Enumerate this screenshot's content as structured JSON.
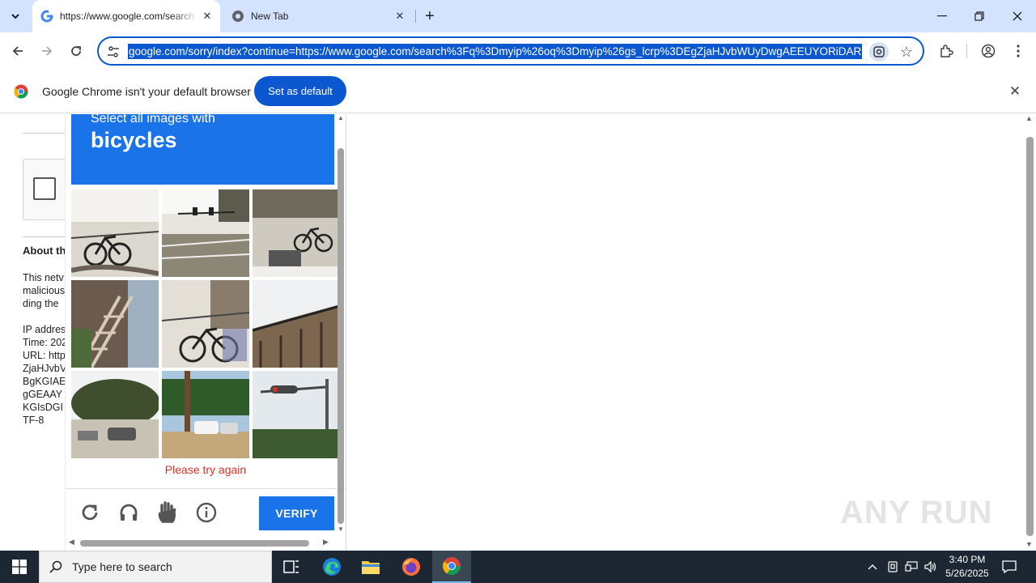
{
  "browser": {
    "tabs": [
      {
        "title": "https://www.google.com/search",
        "active": true
      },
      {
        "title": "New Tab",
        "active": false
      }
    ],
    "url": "google.com/sorry/index?continue=https://www.google.com/search%3Fq%3Dmyip%26oq%3Dmyip%26gs_lcrp%3DEgZjaHJvbWUyDwgAEEUYORiDAR",
    "infobar": {
      "message": "Google Chrome isn't your default browser",
      "button": "Set as default"
    }
  },
  "background_page": {
    "about_heading": "About th",
    "text_lines": [
      "This netv",
      "malicious",
      "ding the",
      "",
      "IP addres",
      "Time: 202",
      "URL: http",
      "ZjaHJvbV",
      "BgKGIAE",
      "gGEAAY",
      "KGIsDGI",
      "TF-8"
    ]
  },
  "captcha": {
    "instruction": "Select all images with",
    "target": "bicycles",
    "tiles": [
      {
        "label": "bicycle parked on sidewalk"
      },
      {
        "label": "street with traffic light"
      },
      {
        "label": "street with bicycle"
      },
      {
        "label": "stairs and railing"
      },
      {
        "label": "bicycle by fence"
      },
      {
        "label": "bridge"
      },
      {
        "label": "trees and cars"
      },
      {
        "label": "parking lot with RVs"
      },
      {
        "label": "traffic light"
      }
    ],
    "error": "Please try again",
    "verify_label": "VERIFY"
  },
  "watermark": "ANY RUN",
  "taskbar": {
    "search_placeholder": "Type here to search",
    "time": "3:40 PM",
    "date": "5/26/2025"
  },
  "colors": {
    "accent": "#1a73e8",
    "chrome_blue": "#0b57d0",
    "error": "#d93025",
    "tabstrip": "#d3e3fd",
    "taskbar": "#1c2733"
  }
}
